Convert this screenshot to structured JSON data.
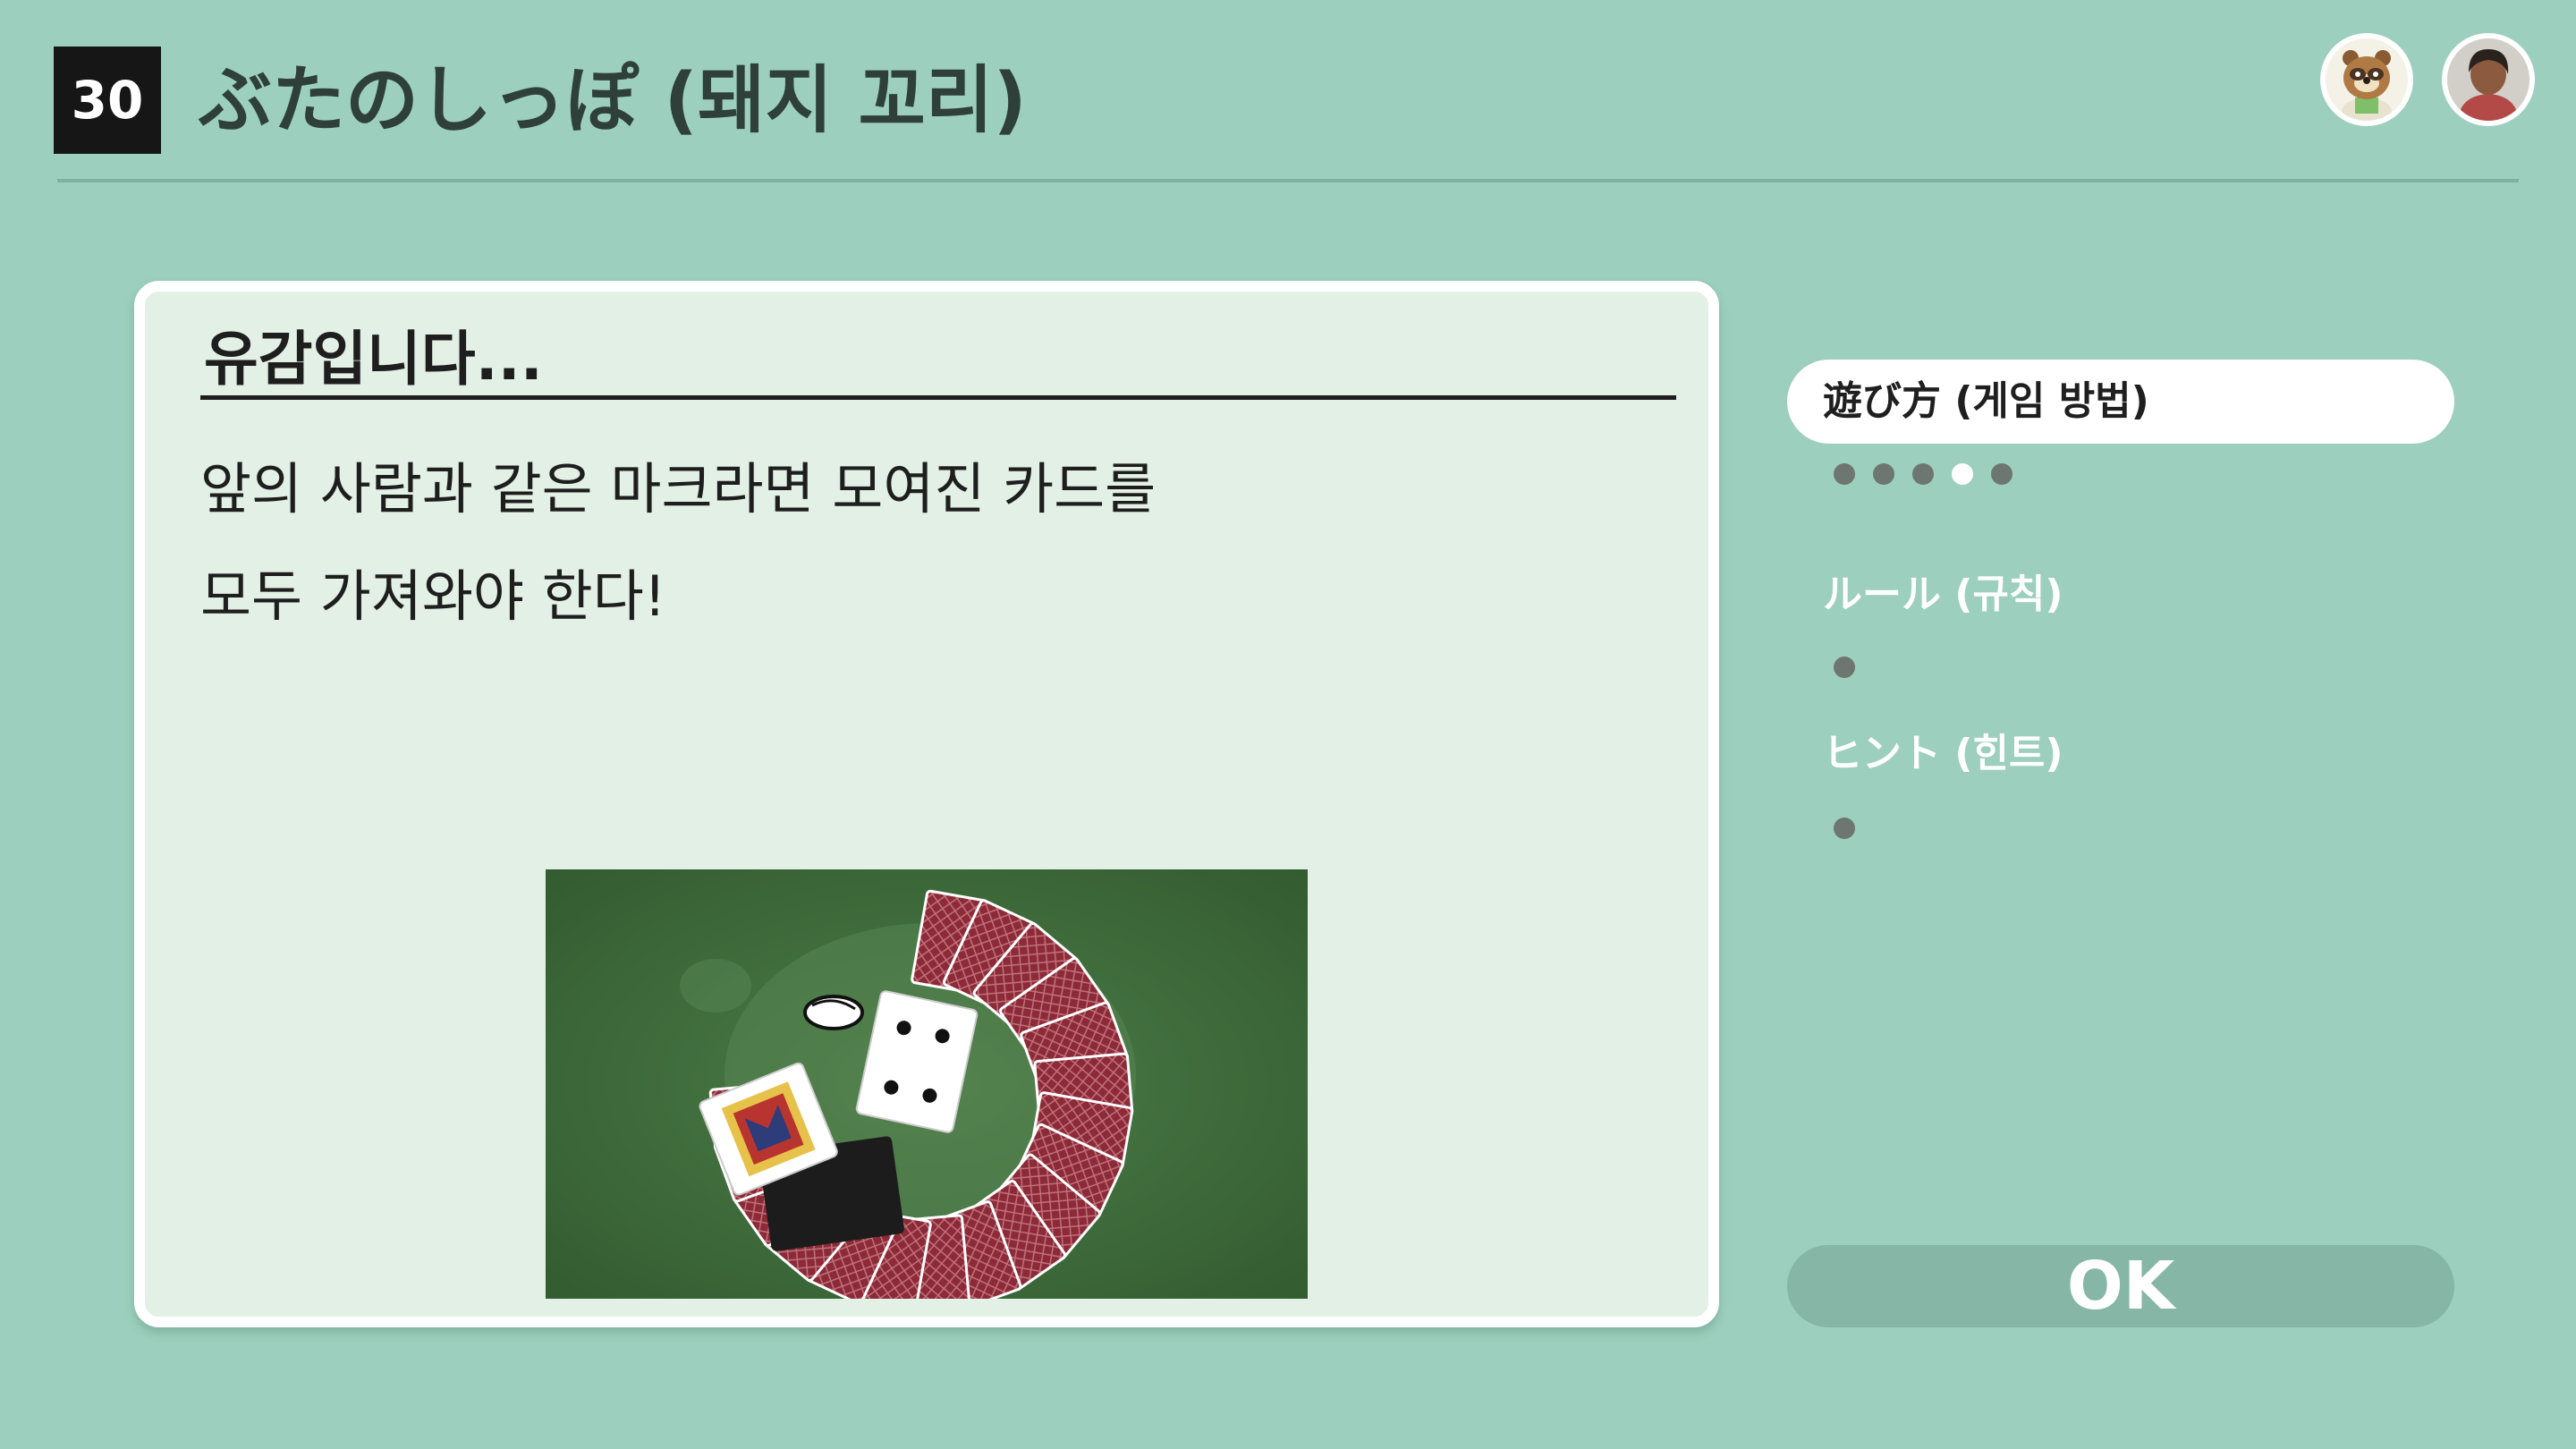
{
  "header": {
    "number": "30",
    "title": "ぶたのしっぽ (돼지 꼬리)"
  },
  "avatars": [
    {
      "name": "npc-avatar"
    },
    {
      "name": "player-avatar"
    }
  ],
  "panel": {
    "title": "유감입니다...",
    "body_line1": "앞의 사람과 같은 마크라면 모여진 카드를",
    "body_line2": "모두 가져와야 한다!"
  },
  "menu": {
    "items": [
      {
        "label": "遊び方 (게임 방법)",
        "page_count": 5,
        "current_page": 4,
        "active": true
      },
      {
        "label": "ルール (규칙)",
        "page_count": 1,
        "current_page": 0,
        "active": false
      },
      {
        "label": "ヒント (힌트)",
        "page_count": 1,
        "current_page": 0,
        "active": false
      }
    ]
  },
  "ok_button": {
    "label": "OK"
  },
  "colors": {
    "background": "#9ccfbd",
    "panel": "#e2f0e6",
    "card_back": "#8c2a38",
    "felt": "#3e6b3a",
    "ok_button": "#86b7a6"
  }
}
